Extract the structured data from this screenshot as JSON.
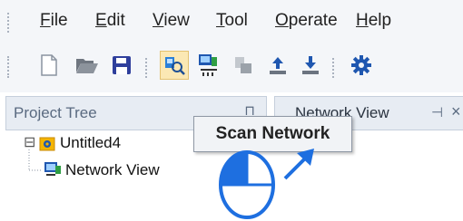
{
  "menu": {
    "items": [
      {
        "first": "F",
        "rest": "ile"
      },
      {
        "first": "E",
        "rest": "dit"
      },
      {
        "first": "V",
        "rest": "iew"
      },
      {
        "first": "T",
        "rest": "ool"
      },
      {
        "first": "O",
        "rest": "perate"
      },
      {
        "first": "H",
        "rest": "elp"
      }
    ]
  },
  "toolbar": {
    "buttons": [
      "new-file-icon",
      "open-folder-icon",
      "save-icon",
      "scan-network-icon",
      "network-device-icon",
      "disconnect-icon",
      "upload-icon",
      "download-icon",
      "settings-gear-icon"
    ]
  },
  "panels": {
    "project_tree": {
      "title": "Project Tree",
      "pin": "⊓"
    },
    "network_view": {
      "title": "Network View",
      "pin": "⊣",
      "close": "×"
    }
  },
  "tree": {
    "root": {
      "expander": "⊟",
      "label": "Untitled4"
    },
    "child": {
      "label": "Network View"
    }
  },
  "tooltip": {
    "text": "Scan Network"
  },
  "colors": {
    "accent_blue": "#1e6fe0",
    "highlight": "#fbe8b4"
  }
}
